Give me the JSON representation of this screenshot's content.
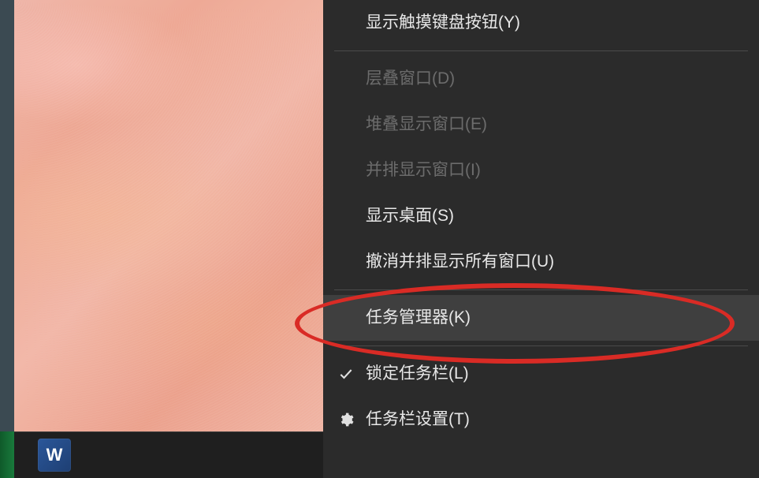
{
  "taskbar": {
    "word_icon_label": "W"
  },
  "context_menu": {
    "items": [
      {
        "label": "显示触摸键盘按钮(Y)",
        "enabled": true,
        "icon": null,
        "hovered": false
      },
      {
        "separator": true
      },
      {
        "label": "层叠窗口(D)",
        "enabled": false,
        "icon": null,
        "hovered": false
      },
      {
        "label": "堆叠显示窗口(E)",
        "enabled": false,
        "icon": null,
        "hovered": false
      },
      {
        "label": "并排显示窗口(I)",
        "enabled": false,
        "icon": null,
        "hovered": false
      },
      {
        "label": "显示桌面(S)",
        "enabled": true,
        "icon": null,
        "hovered": false
      },
      {
        "label": "撤消并排显示所有窗口(U)",
        "enabled": true,
        "icon": null,
        "hovered": false
      },
      {
        "separator": true
      },
      {
        "label": "任务管理器(K)",
        "enabled": true,
        "icon": null,
        "hovered": true
      },
      {
        "separator": true
      },
      {
        "label": "锁定任务栏(L)",
        "enabled": true,
        "icon": "check",
        "hovered": false
      },
      {
        "label": "任务栏设置(T)",
        "enabled": true,
        "icon": "gear",
        "hovered": false
      }
    ]
  },
  "annotation": {
    "target_label": "任务管理器(K)",
    "color": "#d92b25"
  }
}
